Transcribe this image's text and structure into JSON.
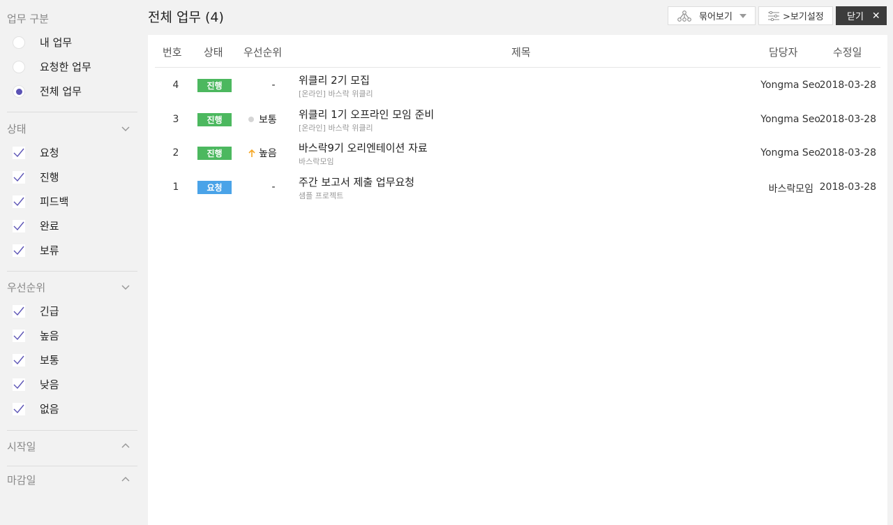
{
  "sidebar": {
    "work_type": {
      "title": "업무 구분",
      "options": [
        {
          "label": "내 업무",
          "selected": false
        },
        {
          "label": "요청한 업무",
          "selected": false
        },
        {
          "label": "전체 업무",
          "selected": true
        }
      ]
    },
    "status": {
      "title": "상태",
      "collapse_icon": "chevron-down-icon",
      "options": [
        {
          "label": "요청",
          "checked": true
        },
        {
          "label": "진행",
          "checked": true
        },
        {
          "label": "피드백",
          "checked": true
        },
        {
          "label": "완료",
          "checked": true
        },
        {
          "label": "보류",
          "checked": true
        }
      ]
    },
    "priority": {
      "title": "우선순위",
      "collapse_icon": "chevron-down-icon",
      "options": [
        {
          "label": "긴급",
          "checked": true
        },
        {
          "label": "높음",
          "checked": true
        },
        {
          "label": "보통",
          "checked": true
        },
        {
          "label": "낮음",
          "checked": true
        },
        {
          "label": "없음",
          "checked": true
        }
      ]
    },
    "start_date": {
      "title": "시작일",
      "collapse_icon": "chevron-up-icon"
    },
    "due_date": {
      "title": "마감일",
      "collapse_icon": "chevron-up-icon"
    }
  },
  "header": {
    "title": "전체 업무 (4)",
    "group_button": "묶어보기",
    "view_settings_button": ">보기설정",
    "close_button": "닫기"
  },
  "table": {
    "columns": {
      "number": "번호",
      "status": "상태",
      "priority": "우선순위",
      "title": "제목",
      "assignee": "담당자",
      "modified": "수정일"
    },
    "rows": [
      {
        "number": "4",
        "status": "진행",
        "status_color": "#4cb85f",
        "priority": "-",
        "priority_icon": "",
        "title": "위클리 2기 모집",
        "project": "[온라인] 바스락 위클리",
        "assignee": "Yongma Seo",
        "modified": "2018-03-28"
      },
      {
        "number": "3",
        "status": "진행",
        "status_color": "#4cb85f",
        "priority": "보통",
        "priority_icon": "dot",
        "title": "위클리 1기 오프라인 모임 준비",
        "project": "[온라인] 바스락 위클리",
        "assignee": "Yongma Seo",
        "modified": "2018-03-28"
      },
      {
        "number": "2",
        "status": "진행",
        "status_color": "#4cb85f",
        "priority": "높음",
        "priority_icon": "arrow-up",
        "title": "바스락9기 오리엔테이션 자료",
        "project": "바스락모임",
        "assignee": "Yongma Seo",
        "modified": "2018-03-28"
      },
      {
        "number": "1",
        "status": "요청",
        "status_color": "#4aa3e8",
        "priority": "-",
        "priority_icon": "",
        "title": "주간 보고서 제출 업무요청",
        "project": "샘플 프로젝트",
        "assignee": "바스락모임",
        "modified": "2018-03-28"
      }
    ]
  },
  "colors": {
    "accent": "#5b53b5",
    "in_progress": "#4cb85f",
    "requested": "#4aa3e8",
    "priority_high": "#f5a623"
  }
}
